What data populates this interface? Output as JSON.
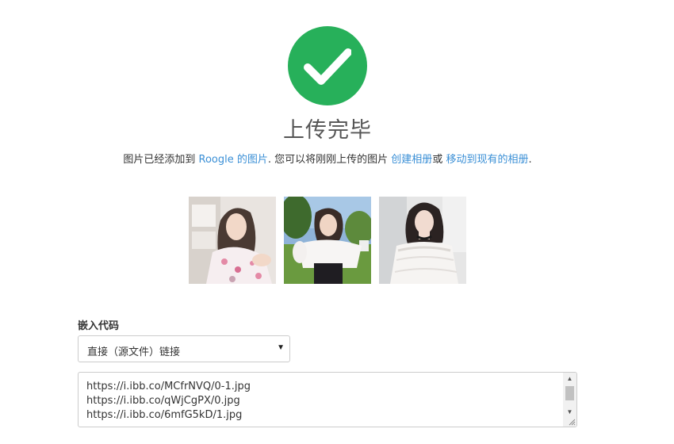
{
  "header": {
    "icon": "check-icon",
    "icon_color": "#27b05a",
    "title": "上传完毕"
  },
  "message": {
    "prefix": "图片已经添加到 ",
    "link_images": "Roogle 的图片",
    "middle": ". 您可以将刚刚上传的图片 ",
    "link_create_album": "创建相册",
    "or": "或 ",
    "link_move_album": "移动到现有的相册",
    "suffix": ".",
    "link_color": "#3a8fd6"
  },
  "thumbnails": [
    {
      "name": "photo-thumbnail-1"
    },
    {
      "name": "photo-thumbnail-2"
    },
    {
      "name": "photo-thumbnail-3"
    }
  ],
  "embed": {
    "label": "嵌入代码",
    "select_value": "直接（源文件）链接",
    "codes": [
      "https://i.ibb.co/MCfrNVQ/0-1.jpg",
      "https://i.ibb.co/qWjCgPX/0.jpg",
      "https://i.ibb.co/6mfG5kD/1.jpg"
    ]
  }
}
